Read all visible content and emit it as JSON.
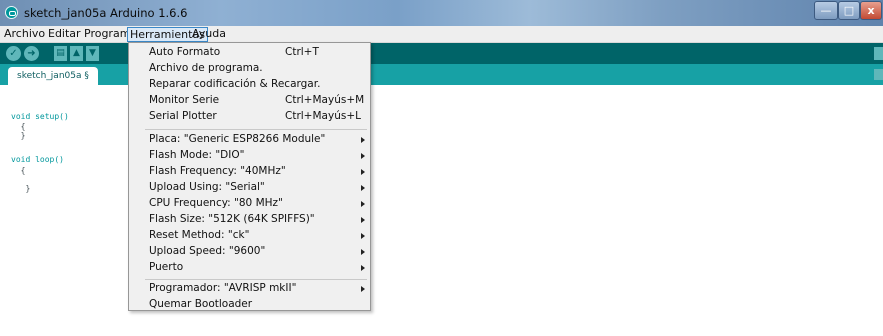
{
  "window": {
    "title": "sketch_jan05a Arduino 1.6.6",
    "icon": "arduino-icon",
    "controls": {
      "minimize": "—",
      "maximize": "□",
      "close": "x"
    }
  },
  "menubar": {
    "items": [
      "Archivo",
      "Editar",
      "Programa",
      "Herramientas",
      "Ayuda"
    ],
    "active": "Herramientas"
  },
  "toolbar": {
    "buttons": [
      {
        "name": "verify",
        "icon": "check-icon",
        "glyph": "✓"
      },
      {
        "name": "upload",
        "icon": "arrow-right-icon",
        "glyph": "➜"
      },
      {
        "name": "new",
        "icon": "new-file-icon",
        "glyph": "▤"
      },
      {
        "name": "open",
        "icon": "open-icon",
        "glyph": "▲"
      },
      {
        "name": "save",
        "icon": "save-icon",
        "glyph": "▼"
      }
    ]
  },
  "tabs": [
    {
      "label": "sketch_jan05a §"
    }
  ],
  "code": {
    "lines": [
      "void setup()",
      "  {",
      "  }",
      "",
      "void loop()",
      "  {",
      "",
      "   }"
    ]
  },
  "dropdown": {
    "items": [
      {
        "label": "Auto Formato",
        "accel": "Ctrl+T"
      },
      {
        "label": "Archivo de programa.",
        "accel": ""
      },
      {
        "label": "Reparar codificación & Recargar.",
        "accel": ""
      },
      {
        "label": "Monitor Serie",
        "accel": "Ctrl+Mayús+M"
      },
      {
        "label": "Serial Plotter",
        "accel": "Ctrl+Mayús+L"
      },
      {
        "label": "Placa: \"Generic ESP8266 Module\"",
        "submenu": true
      },
      {
        "label": "Flash Mode: \"DIO\"",
        "submenu": true
      },
      {
        "label": "Flash Frequency: \"40MHz\"",
        "submenu": true
      },
      {
        "label": "Upload Using: \"Serial\"",
        "submenu": true
      },
      {
        "label": "CPU Frequency: \"80 MHz\"",
        "submenu": true
      },
      {
        "label": "Flash Size: \"512K (64K SPIFFS)\"",
        "submenu": true
      },
      {
        "label": "Reset Method: \"ck\"",
        "submenu": true
      },
      {
        "label": "Upload Speed: \"9600\"",
        "submenu": true
      },
      {
        "label": "Puerto",
        "submenu": true
      },
      {
        "label": "Programador: \"AVRISP mkII\"",
        "submenu": true
      },
      {
        "label": "Quemar Bootloader",
        "accel": ""
      }
    ]
  },
  "colors": {
    "toolbar": "#006468",
    "tabstrip": "#17a1a5",
    "keyword": "#00979c",
    "menu_background": "#f0f0f0"
  }
}
